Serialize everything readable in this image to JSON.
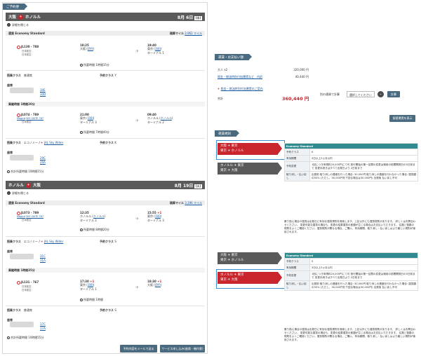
{
  "left_panel": {
    "section_label": "ご予約便",
    "toggle_label": "詳細を閉じる",
    "book_btn": "予約内容をメールで送る",
    "pay_btn": "サービス申し込み(座席・機内食)",
    "outbound": {
      "from": "大阪",
      "to": "ホノルル",
      "date": "8月 6日",
      "dow": "(水)",
      "cabin": "運賃 Economy Standard",
      "miles_label": "積算マイル",
      "miles": "2,962 マイル",
      "seg1": {
        "flight": "JL130 - 788",
        "op": "日本航空",
        "op2": "日本航空",
        "dep_time": "18:25",
        "dep_city": "大阪",
        "dep_apt": "伊丹",
        "arr_time": "19:40",
        "arr_city": "東京",
        "arr_apt": "羽田",
        "arr_term": "ターミナル 1",
        "duration": "所要時間 1時間15分",
        "class_label": "搭乗クラス",
        "class": "普通席",
        "booking_label": "予約クラス",
        "booking": "Y",
        "seat_label": "座席",
        "seat_a": "30E",
        "seat_b": "30D"
      },
      "transit": "乗継時間 1時間20分",
      "seg2": {
        "flight": "JL074 - 789",
        "link": "Magicd",
        "seat_type": "SKY SUITE 787",
        "op": "日本航空",
        "dep_time": "21:00",
        "dep_city": "東京",
        "dep_apt": "羽田",
        "dep_term": "ターミナル 3",
        "arr_time": "09:40",
        "arr_city": "ホノルル",
        "arr_apt": "ホノルル",
        "arr_term": "ターミナル 2",
        "duration": "所要時間 7時間40分",
        "class_label": "搭乗クラス",
        "class": "エコノミー",
        "class_link": "JAL Sky Wider",
        "booking_label": "予約クラス",
        "booking": "K",
        "seat_label": "座席",
        "seat_a": "29C",
        "seat_b": "29A"
      },
      "total": "合計所要時間 10時間15分"
    },
    "inbound": {
      "from": "ホノルル",
      "to": "大阪",
      "date": "8月 19日",
      "dow": "(火)",
      "cabin": "運賃 Economy Standard",
      "miles_label": "積算マイル",
      "miles": "3,196 マイル",
      "seg1": {
        "flight": "JL073 - 789",
        "link": "Magicd",
        "seat_type": "SKY SUITE 787",
        "op": "日本航空",
        "dep_time": "12:35",
        "dep_city": "ホノルル",
        "dep_apt": "ホノルル",
        "dep_term": "ターミナル 2",
        "arr_time": "15:55",
        "arr_plus": "+1",
        "arr_city": "東京",
        "arr_apt": "羽田",
        "arr_term": "ターミナル 3",
        "duration": "所要時間 8時間20分",
        "class_label": "搭乗クラス",
        "class": "エコノミー",
        "class_link": "JAL Sky Wider",
        "booking_label": "予約クラス",
        "booking": "S",
        "seat_label": "座席",
        "seat_a": "31C",
        "seat_b": "31A"
      },
      "transit": "乗継時間 1時間35分",
      "seg2": {
        "flight": "JL131 - 767",
        "op": "日本航空",
        "op2": "日本航空",
        "dep_time": "17:30",
        "dep_plus": "+1",
        "dep_city": "東京",
        "dep_apt": "羽田",
        "dep_term": "ターミナル 1",
        "arr_time": "18:30",
        "arr_plus": "+1",
        "arr_city": "大阪",
        "arr_apt": "伊丹",
        "duration": "所要時間 1時間",
        "class_label": "搭乗クラス",
        "class": "普通席",
        "booking_label": "予約クラス",
        "booking": "S",
        "seat_label": "座席",
        "seat_a": "17C",
        "seat_b": "17A"
      },
      "total": "合計所要時間 10時間55分"
    }
  },
  "fare_panel": {
    "section_label": "運賃・お支払い額",
    "adult_label": "大人 x2",
    "adult_value": "320,000 円",
    "tax_link": "税金・燃油特別付加運賃など　内訳",
    "tax_value": "40,440 円",
    "tax_note": "税金・燃油特別付加運賃のご案内",
    "total_label": "合計",
    "total_value": "360,440 円",
    "currency_label": "別の通貨で計算",
    "currency_select": "選択してください",
    "calc_btn": "計算",
    "detail_btn": "振替運賃を表示"
  },
  "rules_panel": {
    "section_label": "運賃規則",
    "groupA": {
      "tab_active": {
        "line1_from": "大阪",
        "line1_to": "東京",
        "line2_from": "東京",
        "line2_to": "ホノルル"
      },
      "tab_inactive": {
        "line1_from": "ホノルル",
        "line1_to": "東京",
        "line2_from": "東京",
        "line2_to": "大阪"
      },
      "table_head": "Economy Standard",
      "rows": [
        {
          "k": "予約クラス",
          "v": "K"
        },
        {
          "k": "有効期間",
          "v": "3日以上2ヵ月以内"
        },
        {
          "k": "予約変更",
          "v": "1回につき申請料20,000円にて可 旅行開始の第一区間の変更は適用の前間開発日の5日前まで 変更手続きはすべて出発日より 2日前まで"
        },
        {
          "k": "取り消し・払い戻し",
          "v": "出発前 取り消しの連絡を行った場合: 30,000円 取り消しの連絡を行わなかった場合: 運賃額の50% (ただし、30,000円を下回る場合は30,000円) 出発後 払い戻し不可"
        }
      ],
      "note": "乗り換え場合の運賃は出発日に有効な運賃規則を適用します。上記以外にも運賃規則があります。 詳しくはお問合わせください。 変更可能な運賃の場合も、変更の結果運賃の差額が生じる場合はお支払いただきます。 往路と復路の規則をよくご確認ください。運賃規則が異なる場合、ご購入、有効期間、取り消し・払い戻しはより厳しい規則が適用されます。"
    },
    "groupB": {
      "tab_inactive": {
        "line1_from": "大阪",
        "line1_to": "東京",
        "line2_from": "東京",
        "line2_to": "ホノルル"
      },
      "tab_active": {
        "line1_from": "ホノルル",
        "line1_to": "東京",
        "line2_from": "東京",
        "line2_to": "大阪"
      },
      "table_head": "Economy Standard",
      "rows": [
        {
          "k": "予約クラス",
          "v": "S"
        },
        {
          "k": "有効期間",
          "v": "3日以上2ヵ月以内"
        },
        {
          "k": "予約変更",
          "v": "1回につき申請料20,000円にて可 旅行開始の第一区間の変更は適用の前間開発日の5日前まで 変更手続きはすべて出発日より 2日前まで"
        },
        {
          "k": "取り消し・払い戻し",
          "v": "出発前 取り消しの連絡を行った場合: 30,000円 取り消しの連絡を行わなかった場合: 運賃額の50% (ただし、30,000円を下回る場合は30,000円) 出発後 払い戻し不可"
        }
      ],
      "note": "乗り換え場合の運賃は出発日に有効な運賃規則を適用します。上記以外にも運賃規則があります。 詳しくはお問合わせください。 変更可能な運賃の場合も、変更の結果運賃の差額が生じる場合はお支払いただきます。 往路と復路の規則をよくご確認ください。運賃規則が異なる場合、ご購入、有効期間、取り消し・払い戻しはより厳しい規則が適用されます。"
    }
  }
}
